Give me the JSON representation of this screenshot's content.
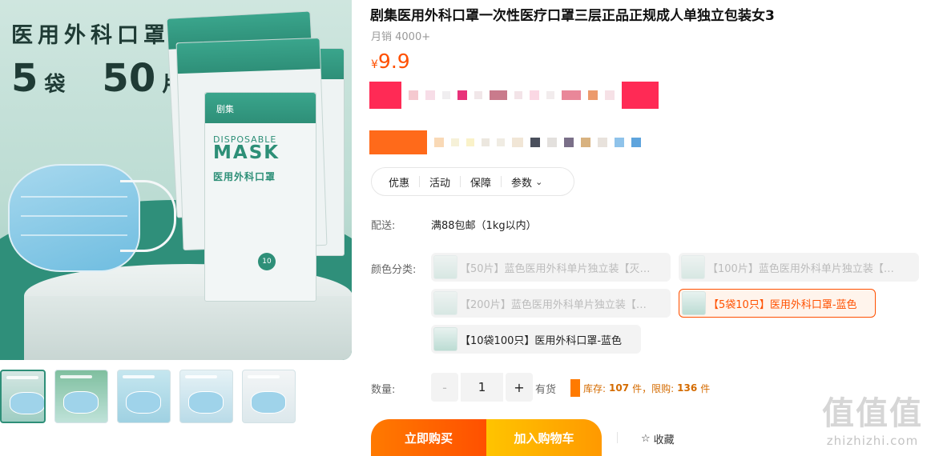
{
  "product": {
    "title": "剧集医用外科口罩一次性医疗口罩三层正品正规成人单独立包装女3",
    "monthly_sales": "月销 4000+",
    "price_currency": "¥",
    "price_value": "9.9"
  },
  "main_image": {
    "headline": "医用外科口罩",
    "bags_number": "5",
    "bags_unit": "袋",
    "pieces_number": "50",
    "pieces_unit": "片",
    "box_brand": "剧集",
    "box_disposable": "DISPOSABLE",
    "box_mask": "MASK",
    "box_cn_name": "医用外科口罩",
    "box_pcs": "10"
  },
  "tabs": [
    {
      "label": "优惠"
    },
    {
      "label": "活动"
    },
    {
      "label": "保障"
    },
    {
      "label": "参数"
    }
  ],
  "shipping": {
    "label": "配送:",
    "value": "满88包邮（1kg以内）"
  },
  "color_options": {
    "label": "颜色分类:",
    "items": [
      {
        "label": "【50片】蓝色医用外科单片独立装【灭…",
        "state": "disabled"
      },
      {
        "label": "【100片】蓝色医用外科单片独立装【…",
        "state": "disabled"
      },
      {
        "label": "【200片】蓝色医用外科单片独立装【…",
        "state": "disabled"
      },
      {
        "label": "【5袋10只】医用外科口罩-蓝色",
        "state": "selected"
      },
      {
        "label": "【10袋100只】医用外科口罩-蓝色",
        "state": "normal"
      }
    ]
  },
  "quantity": {
    "label": "数量:",
    "decrement": "-",
    "value": "1",
    "increment": "+",
    "availability": "有货",
    "stock_prefix": "库存:",
    "stock_count": "107",
    "stock_unit": "件，限购:",
    "limit_count": "136",
    "limit_unit": "件"
  },
  "actions": {
    "buy_now": "立即购买",
    "add_to_cart": "加入购物车",
    "favorite": "收藏",
    "favorite_icon": "☆"
  },
  "watermark": {
    "logo": "值值值",
    "url": "zhizhizhi.com"
  },
  "colors": {
    "accent": "#ff5000",
    "cart_yellow": "#ffb400",
    "brand_green": "#2e8f78"
  }
}
